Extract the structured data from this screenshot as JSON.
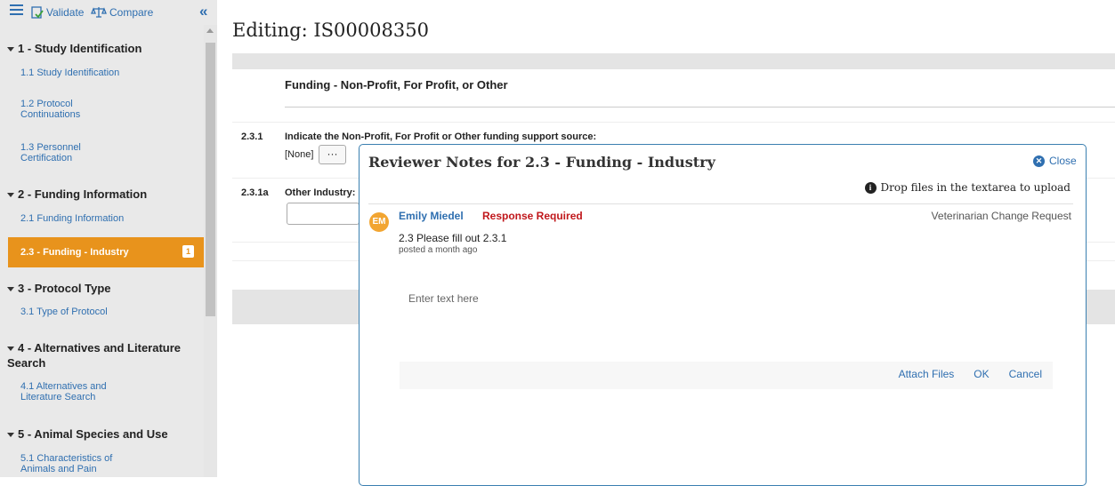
{
  "toolbar": {
    "validate_label": "Validate",
    "compare_label": "Compare",
    "collapse_glyph": "«"
  },
  "nav": {
    "sections": [
      {
        "title": "1 - Study Identification",
        "items": [
          "1.1 Study Identification",
          "1.2 Protocol Continuations",
          "1.3 Personnel Certification"
        ]
      },
      {
        "title": "2 - Funding Information",
        "items": [
          "2.1 Funding Information",
          "2.3 - Funding - Industry"
        ]
      },
      {
        "title": "3 - Protocol Type",
        "items": [
          "3.1 Type of Protocol"
        ]
      },
      {
        "title": "4 - Alternatives and Literature Search",
        "items": [
          "4.1 Alternatives and Literature Search"
        ]
      },
      {
        "title": "5 - Animal Species and Use",
        "items": [
          "5.1 Characteristics of Animals and Pain"
        ]
      }
    ],
    "active_badge": "1"
  },
  "page": {
    "title": "Editing: IS00008350",
    "form_heading": "Funding - Non-Profit, For Profit, or Other",
    "q1_num": "2.3.1",
    "q1_text": "Indicate the Non-Profit, For Profit or Other funding support source:",
    "q1_value": "[None]",
    "q1_button": "···",
    "q2_num": "2.3.1a",
    "q2_text": "Other Industry:"
  },
  "modal": {
    "title": "Reviewer Notes for 2.3 - Funding - Industry",
    "close_label": "Close",
    "drop_hint": "Drop files in the textarea to upload",
    "note": {
      "avatar": "EM",
      "author": "Emily Miedel",
      "status": "Response Required",
      "category": "Veterinarian Change Request",
      "text": "2.3 Please fill out 2.3.1",
      "time": "posted a month ago"
    },
    "reply": {
      "placeholder": "Enter text here",
      "attach_label": "Attach Files",
      "ok_label": "OK",
      "cancel_label": "Cancel"
    }
  },
  "colors": {
    "accent": "#2f6fb0",
    "active_nav": "#e8931c",
    "required": "#c0171b",
    "avatar": "#f2a531"
  }
}
